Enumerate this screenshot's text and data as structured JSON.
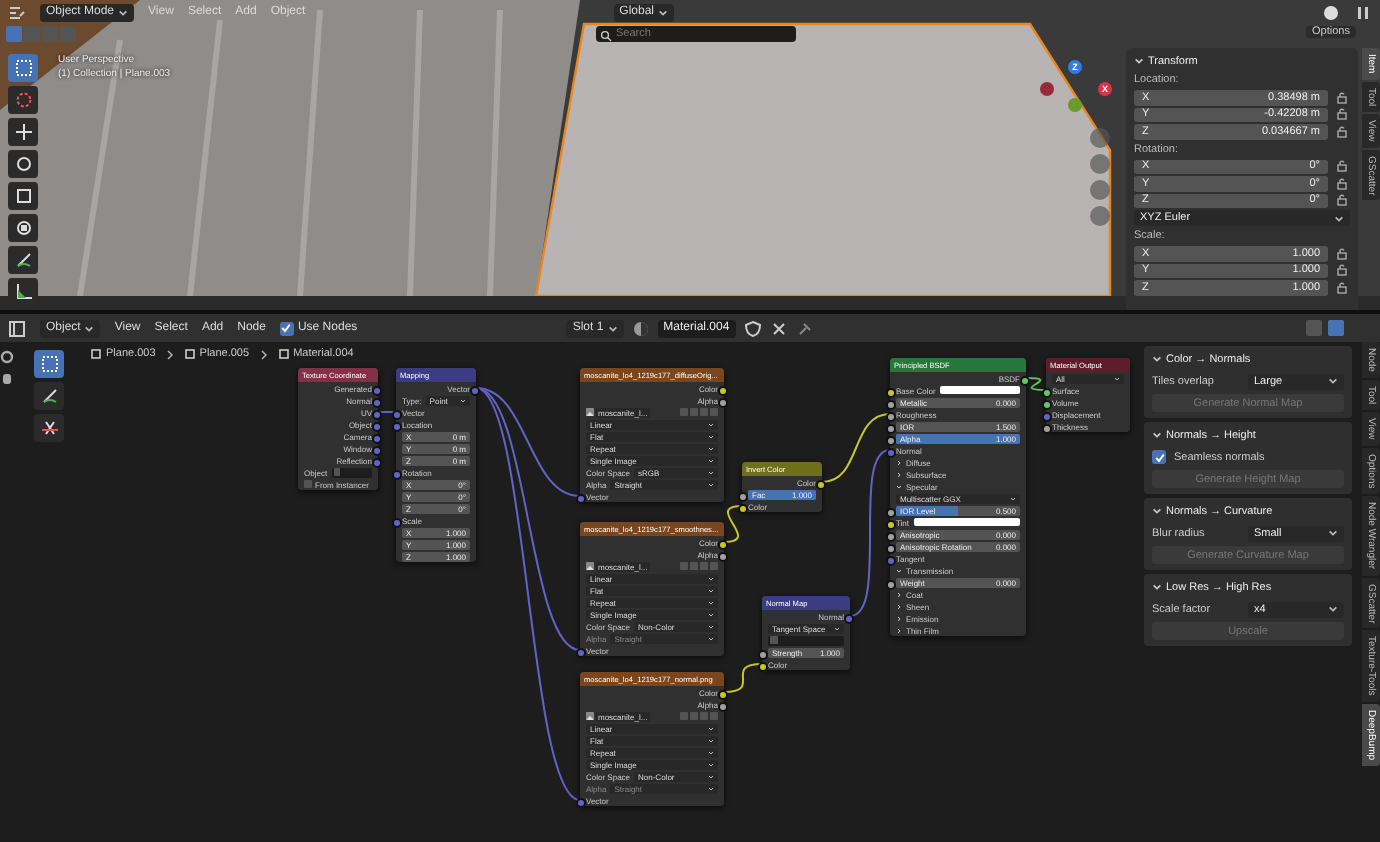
{
  "viewport": {
    "header": {
      "mode": "Object Mode",
      "menus": [
        "View",
        "Select",
        "Add",
        "Object"
      ],
      "orientation": "Global",
      "search": {
        "placeholder": "Search"
      },
      "options": "Options"
    },
    "overlay_text": [
      "User Perspective",
      "(1) Collection | Plane.003"
    ],
    "gizmo": {
      "axes": [
        "Z",
        "X"
      ]
    },
    "sidebar": {
      "tabs": [
        {
          "label": "Item",
          "selected": true
        },
        {
          "label": "Tool",
          "selected": false
        },
        {
          "label": "View",
          "selected": false
        },
        {
          "label": "GScatter",
          "selected": false
        }
      ],
      "transform": {
        "title": "Transform",
        "location_label": "Location:",
        "location": [
          {
            "axis": "X",
            "value": "0.38498 m"
          },
          {
            "axis": "Y",
            "value": "-0.42208 m"
          },
          {
            "axis": "Z",
            "value": "0.034667 m"
          }
        ],
        "rotation_label": "Rotation:",
        "rotation": [
          {
            "axis": "X",
            "value": "0°"
          },
          {
            "axis": "Y",
            "value": "0°"
          },
          {
            "axis": "Z",
            "value": "0°"
          }
        ],
        "rotation_mode": "XYZ Euler",
        "scale_label": "Scale:",
        "scale": [
          {
            "axis": "X",
            "value": "1.000"
          },
          {
            "axis": "Y",
            "value": "1.000"
          },
          {
            "axis": "Z",
            "value": "1.000"
          }
        ]
      }
    }
  },
  "node_editor": {
    "header": {
      "mode": "Object",
      "menus": [
        "View",
        "Select",
        "Add",
        "Node"
      ],
      "use_nodes": {
        "label": "Use Nodes",
        "checked": true
      },
      "slot": "Slot 1",
      "material": "Material.004"
    },
    "breadcrumbs": [
      "Plane.003",
      "Plane.005",
      "Material.004"
    ],
    "nodes": [
      {
        "title": "Texture Coordinate",
        "kind": "input",
        "rows": [
          {
            "kind": "out",
            "label": "Generated",
            "color": "#6363c7"
          },
          {
            "kind": "out",
            "label": "Normal",
            "color": "#6363c7"
          },
          {
            "kind": "out",
            "label": "UV",
            "color": "#6363c7"
          },
          {
            "kind": "out",
            "label": "Object",
            "color": "#6363c7"
          },
          {
            "kind": "out",
            "label": "Camera",
            "color": "#6363c7"
          },
          {
            "kind": "out",
            "label": "Window",
            "color": "#6363c7"
          },
          {
            "kind": "out",
            "label": "Reflection",
            "color": "#6363c7"
          },
          {
            "kind": "object",
            "label": "Object"
          },
          {
            "kind": "check",
            "label": "From Instancer",
            "checked": false
          }
        ]
      },
      {
        "title": "Mapping",
        "kind": "vector",
        "rows": [
          {
            "kind": "out",
            "label": "Vector",
            "color": "#6363c7"
          },
          {
            "kind": "dropdown",
            "label": "Type:",
            "value": "Point"
          },
          {
            "kind": "in",
            "label": "Vector",
            "color": "#6363c7"
          },
          {
            "kind": "in",
            "label": "Location",
            "color": "#6363c7"
          },
          {
            "kind": "field",
            "label": "X",
            "value": "0 m"
          },
          {
            "kind": "field",
            "label": "Y",
            "value": "0 m"
          },
          {
            "kind": "field",
            "label": "Z",
            "value": "0 m"
          },
          {
            "kind": "in",
            "label": "Rotation",
            "color": "#6363c7"
          },
          {
            "kind": "field",
            "label": "X",
            "value": "0°"
          },
          {
            "kind": "field",
            "label": "Y",
            "value": "0°"
          },
          {
            "kind": "field",
            "label": "Z",
            "value": "0°"
          },
          {
            "kind": "in",
            "label": "Scale",
            "color": "#6363c7"
          },
          {
            "kind": "field",
            "label": "X",
            "value": "1.000"
          },
          {
            "kind": "field",
            "label": "Y",
            "value": "1.000"
          },
          {
            "kind": "field",
            "label": "Z",
            "value": "1.000"
          }
        ]
      },
      {
        "title": "moscanite_lo4_1219c177_diffuseOrig...",
        "kind": "texture",
        "rows": [
          {
            "kind": "out",
            "label": "Color",
            "color": "#c7c729"
          },
          {
            "kind": "out",
            "label": "Alpha",
            "color": "#a1a1a1"
          },
          {
            "kind": "image",
            "value": "moscanite_l..."
          },
          {
            "kind": "dropdown",
            "value": "Linear"
          },
          {
            "kind": "dropdown",
            "value": "Flat"
          },
          {
            "kind": "dropdown",
            "value": "Repeat"
          },
          {
            "kind": "dropdown",
            "value": "Single Image"
          },
          {
            "kind": "dropdown",
            "label": "Color Space",
            "value": "sRGB"
          },
          {
            "kind": "dropdown",
            "label": "Alpha",
            "value": "Straight",
            "disabled": false
          },
          {
            "kind": "in",
            "label": "Vector",
            "color": "#6363c7"
          }
        ]
      },
      {
        "title": "moscanite_lo4_1219c177_smoothnes...",
        "kind": "texture",
        "rows": [
          {
            "kind": "out",
            "label": "Color",
            "color": "#c7c729"
          },
          {
            "kind": "out",
            "label": "Alpha",
            "color": "#a1a1a1"
          },
          {
            "kind": "image",
            "value": "moscanite_l..."
          },
          {
            "kind": "dropdown",
            "value": "Linear"
          },
          {
            "kind": "dropdown",
            "value": "Flat"
          },
          {
            "kind": "dropdown",
            "value": "Repeat"
          },
          {
            "kind": "dropdown",
            "value": "Single Image"
          },
          {
            "kind": "dropdown",
            "label": "Color Space",
            "value": "Non-Color"
          },
          {
            "kind": "dropdown",
            "label": "Alpha",
            "value": "Straight",
            "disabled": true
          },
          {
            "kind": "in",
            "label": "Vector",
            "color": "#6363c7"
          }
        ]
      },
      {
        "title": "moscanite_lo4_1219c177_normal.png",
        "kind": "texture",
        "rows": [
          {
            "kind": "out",
            "label": "Color",
            "color": "#c7c729"
          },
          {
            "kind": "out",
            "label": "Alpha",
            "color": "#a1a1a1"
          },
          {
            "kind": "image",
            "value": "moscanite_l..."
          },
          {
            "kind": "dropdown",
            "value": "Linear"
          },
          {
            "kind": "dropdown",
            "value": "Flat"
          },
          {
            "kind": "dropdown",
            "value": "Repeat"
          },
          {
            "kind": "dropdown",
            "value": "Single Image"
          },
          {
            "kind": "dropdown",
            "label": "Color Space",
            "value": "Non-Color"
          },
          {
            "kind": "dropdown",
            "label": "Alpha",
            "value": "Straight",
            "disabled": true
          },
          {
            "kind": "in",
            "label": "Vector",
            "color": "#6363c7"
          }
        ]
      },
      {
        "title": "Invert Color",
        "kind": "color",
        "rows": [
          {
            "kind": "out",
            "label": "Color",
            "color": "#c7c729"
          },
          {
            "kind": "field",
            "label": "Fac",
            "value": "1.000",
            "level": 1,
            "color": "#a1a1a1"
          },
          {
            "kind": "in",
            "label": "Color",
            "color": "#c7c729"
          }
        ]
      },
      {
        "title": "Normal Map",
        "kind": "vector",
        "rows": [
          {
            "kind": "out",
            "label": "Normal",
            "color": "#6363c7"
          },
          {
            "kind": "dropdown",
            "value": "Tangent Space"
          },
          {
            "kind": "object"
          },
          {
            "kind": "field",
            "label": "Strength",
            "value": "1.000",
            "color": "#a1a1a1"
          },
          {
            "kind": "in",
            "label": "Color",
            "color": "#c7c729"
          }
        ]
      },
      {
        "title": "Principled BSDF",
        "kind": "shader",
        "rows": [
          {
            "kind": "out",
            "label": "BSDF",
            "color": "#63c763"
          },
          {
            "kind": "color",
            "label": "Base Color",
            "color": "#c7c729"
          },
          {
            "kind": "field",
            "label": "Metallic",
            "value": "0.000",
            "level": 0,
            "color": "#a1a1a1"
          },
          {
            "kind": "in",
            "label": "Roughness",
            "color": "#a1a1a1"
          },
          {
            "kind": "field",
            "label": "IOR",
            "value": "1.500",
            "color": "#a1a1a1"
          },
          {
            "kind": "field",
            "label": "Alpha",
            "value": "1.000",
            "level": 1,
            "color": "#a1a1a1"
          },
          {
            "kind": "in",
            "label": "Normal",
            "color": "#6363c7"
          },
          {
            "kind": "panel",
            "label": "Diffuse",
            "expanded": false
          },
          {
            "kind": "panel",
            "label": "Subsurface",
            "expanded": false
          },
          {
            "kind": "panel",
            "label": "Specular",
            "expanded": true
          },
          {
            "kind": "dropdown",
            "value": "Multiscatter GGX"
          },
          {
            "kind": "field",
            "label": "IOR Level",
            "value": "0.500",
            "level": 0.5,
            "color": "#a1a1a1"
          },
          {
            "kind": "color",
            "label": "Tint",
            "color": "#c7c729"
          },
          {
            "kind": "field",
            "label": "Anisotropic",
            "value": "0.000",
            "level": 0,
            "color": "#a1a1a1"
          },
          {
            "kind": "field",
            "label": "Anisotropic Rotation",
            "value": "0.000",
            "level": 0,
            "color": "#a1a1a1"
          },
          {
            "kind": "in",
            "label": "Tangent",
            "color": "#6363c7"
          },
          {
            "kind": "panel",
            "label": "Transmission",
            "expanded": true
          },
          {
            "kind": "field",
            "label": "Weight",
            "value": "0.000",
            "level": 0,
            "color": "#a1a1a1"
          },
          {
            "kind": "panel",
            "label": "Coat",
            "expanded": false
          },
          {
            "kind": "panel",
            "label": "Sheen",
            "expanded": false
          },
          {
            "kind": "panel",
            "label": "Emission",
            "expanded": false
          },
          {
            "kind": "panel",
            "label": "Thin Film",
            "expanded": false
          }
        ]
      },
      {
        "title": "Material Output",
        "kind": "output",
        "rows": [
          {
            "kind": "dropdown",
            "value": "All"
          },
          {
            "kind": "in",
            "label": "Surface",
            "color": "#63c763"
          },
          {
            "kind": "in",
            "label": "Volume",
            "color": "#63c763"
          },
          {
            "kind": "in",
            "label": "Displacement",
            "color": "#6363c7"
          },
          {
            "kind": "in",
            "label": "Thickness",
            "color": "#a1a1a1"
          }
        ]
      }
    ],
    "sidebar": {
      "tabs": [
        {
          "label": "Node",
          "selected": false
        },
        {
          "label": "Tool",
          "selected": false
        },
        {
          "label": "View",
          "selected": false
        },
        {
          "label": "Options",
          "selected": false
        },
        {
          "label": "Node Wrangler",
          "selected": false
        },
        {
          "label": "GScatter",
          "selected": false
        },
        {
          "label": "Texture-Tools",
          "selected": false
        },
        {
          "label": "DeepBump",
          "selected": true
        }
      ],
      "sections": [
        {
          "title": "Color → Normals",
          "rows": [
            {
              "kind": "dropdown",
              "label": "Tiles overlap",
              "value": "Large"
            },
            {
              "kind": "button",
              "label": "Generate Normal Map",
              "disabled": true
            }
          ]
        },
        {
          "title": "Normals → Height",
          "rows": [
            {
              "kind": "check",
              "label": "Seamless normals",
              "checked": true
            },
            {
              "kind": "button",
              "label": "Generate Height Map",
              "disabled": true
            }
          ]
        },
        {
          "title": "Normals → Curvature",
          "rows": [
            {
              "kind": "dropdown",
              "label": "Blur radius",
              "value": "Small"
            },
            {
              "kind": "button",
              "label": "Generate Curvature Map",
              "disabled": true
            }
          ]
        },
        {
          "title": "Low Res → High Res",
          "rows": [
            {
              "kind": "dropdown",
              "label": "Scale factor",
              "value": "x4"
            },
            {
              "kind": "button",
              "label": "Upscale",
              "disabled": true
            }
          ]
        }
      ]
    }
  }
}
